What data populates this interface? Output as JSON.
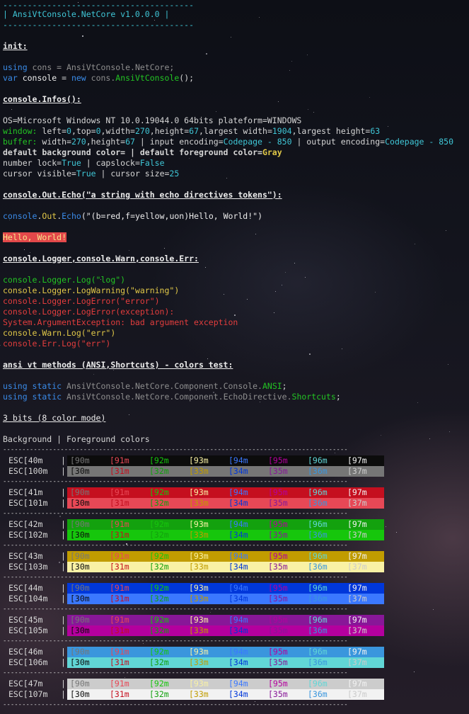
{
  "header": {
    "rule": "---------------------------------------",
    "title": "| AnsiVtConsole.NetCore v1.0.0.0 |"
  },
  "sections": {
    "init": "init:",
    "infos": "console.Infos():",
    "echo": "console.Out.Echo(\"a string with echo directives tokens\"):",
    "logger": "console.Logger,console.Warn,console.Err:",
    "ansi": "ansi vt methods (ANSI,Shortcuts) - colors test:",
    "bits": "3 bits (8 color mode)"
  },
  "init": {
    "using_kw": "using",
    "using_ns": " cons = AnsiVtConsole.NetCore;",
    "var_kw": "var",
    "var_name": " console",
    "var_eq": " = ",
    "new_kw": "new",
    "var_type": " cons.",
    "var_cls": "AnsiVtConsole",
    "var_end": "();"
  },
  "infos": {
    "os": "OS=Microsoft Windows NT 10.0.19044.0 64bits plateform=WINDOWS",
    "window_lbl": "window:",
    "window_a": " left=",
    "window_left": "0",
    "window_b": ",top=",
    "window_top": "0",
    "window_c": ",width=",
    "window_width": "270",
    "window_d": ",height=",
    "window_height": "67",
    "window_e": ",largest width=",
    "window_lw": "1904",
    "window_f": ",largest height=",
    "window_lh": "63",
    "buffer_lbl": "buffer:",
    "buffer_a": " width=",
    "buffer_width": "270",
    "buffer_b": ",height=",
    "buffer_height": "67",
    "buffer_c": " | input encoding=",
    "buffer_in": "Codepage - 850",
    "buffer_d": " | output encoding=",
    "buffer_out": "Codepage - 850",
    "bg_line": "default background color= | default foreground color=",
    "fg_value": "Gray",
    "numlock_a": "number lock=",
    "numlock": "True",
    "numlock_b": " | capslock=",
    "capslock": "False",
    "cursor_a": "cursor visible=",
    "cursor_visible": "True",
    "cursor_b": " | cursor size=",
    "cursor_size": "25"
  },
  "echo": {
    "obj": "console",
    "dot1": ".",
    "out": "Out",
    "dot2": ".",
    "fn": "Echo",
    "args": "(\"(b=red,f=yellow,uon)Hello, World!\")",
    "hello": "Hello, World!"
  },
  "logger": {
    "log": "console.Logger.Log(\"log\")",
    "warning": "console.Logger.LogWarning(\"warning\")",
    "error": "console.Logger.LogError(\"error\")",
    "exception": "console.Logger.LogError(exception):",
    "exception_msg": "System.ArgumentException: bad argument exception",
    "warn": "console.Warn.Log(\"err\")",
    "err": "console.Err.Log(\"err\")"
  },
  "ansi": {
    "kw1": "using static",
    "ns1": " AnsiVtConsole.NetCore.Component.Console.",
    "cls1": "ANSI",
    "end1": ";",
    "kw2": "using static",
    "ns2": " AnsiVtConsole.NetCore.Component.EchoDirective.",
    "cls2": "Shortcuts",
    "end2": ";"
  },
  "table": {
    "header": "Background | Foreground colors",
    "sep": "------------------------------------------------------------------------------------------",
    "fg_codes_bright": [
      "[90m",
      "[91m",
      "[92m",
      "[93m",
      "[94m",
      "[95m",
      "[96m",
      "[97m"
    ],
    "fg_codes_normal": [
      "[30m",
      "[31m",
      "[32m",
      "[33m",
      "[34m",
      "[35m",
      "[36m",
      "[37m"
    ],
    "groups": [
      {
        "lbl1": "ESC[40m",
        "lbl2": "ESC[100m",
        "bg1": "#0c0c0c",
        "bg2": "#767676"
      },
      {
        "lbl1": "ESC[41m",
        "lbl2": "ESC[101m",
        "bg1": "#c50f1f",
        "bg2": "#e74856"
      },
      {
        "lbl1": "ESC[42m",
        "lbl2": "ESC[102m",
        "bg1": "#13a10e",
        "bg2": "#16c60c"
      },
      {
        "lbl1": "ESC[43m",
        "lbl2": "ESC[103m",
        "bg1": "#c19c00",
        "bg2": "#f9f1a5"
      },
      {
        "lbl1": "ESC[44m",
        "lbl2": "ESC[104m",
        "bg1": "#0037da",
        "bg2": "#3b78ff"
      },
      {
        "lbl1": "ESC[45m",
        "lbl2": "ESC[105m",
        "bg1": "#881798",
        "bg2": "#b4009e"
      },
      {
        "lbl1": "ESC[46m",
        "lbl2": "ESC[106m",
        "bg1": "#3a96dd",
        "bg2": "#61d6d6"
      },
      {
        "lbl1": "ESC[47m",
        "lbl2": "ESC[107m",
        "bg1": "#cccccc",
        "bg2": "#f2f2f2"
      }
    ],
    "fg_colors_bright": [
      "#767676",
      "#e74856",
      "#16c60c",
      "#f9f1a5",
      "#3b78ff",
      "#b4009e",
      "#61d6d6",
      "#f2f2f2"
    ],
    "fg_colors_normal": [
      "#0c0c0c",
      "#c50f1f",
      "#13a10e",
      "#c19c00",
      "#0037da",
      "#881798",
      "#3a96dd",
      "#cccccc"
    ]
  },
  "colors": {
    "cyan": "#3fc6d6",
    "blue": "#3a8be8",
    "green": "#23c423",
    "yellow": "#e1c848",
    "red": "#e33d3d",
    "gray": "#8e8e8e"
  }
}
